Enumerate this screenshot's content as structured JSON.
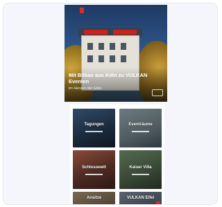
{
  "hero": {
    "badge": "",
    "title": "Mit Bilbao aus Köln zu VULKAN Eventen",
    "subtitle": "im Herzen der Eifel"
  },
  "tiles": [
    {
      "label": "Tagungen"
    },
    {
      "label": "Eventräume"
    },
    {
      "label": "Schlosswelt"
    },
    {
      "label": "Kaiser Villa"
    },
    {
      "label": "Ansitze"
    },
    {
      "label": "VULKAN Eifel",
      "tag": ""
    }
  ],
  "colors": {
    "accent": "#d32f2f",
    "card_bg": "#f4f6fb"
  }
}
